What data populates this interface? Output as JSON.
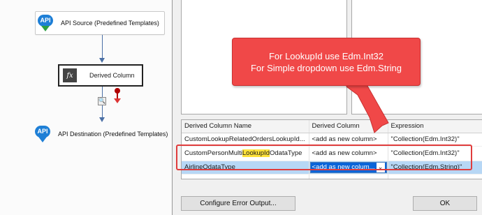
{
  "flow": {
    "source_label": "API Source (Predefined Templates)",
    "source_icon": "API",
    "derived_label": "Derived Column",
    "derived_icon": "fx",
    "destination_label": "API Destination (Predefined Templates)",
    "destination_icon": "API"
  },
  "callout": {
    "line1": "For LookupId use Edm.Int32",
    "line2": "For Simple dropdown use Edm.String",
    "color": "#f04848"
  },
  "grid": {
    "headers": [
      "Derived Column Name",
      "Derived Column",
      "Expression"
    ],
    "rows": [
      {
        "name": "CustomLookupRelatedOrdersLookupId...",
        "derived": "<add as new column>",
        "expression": "\"Collection(Edm.Int32)\""
      },
      {
        "name_pre": "CustomPersonMulti",
        "name_hl": "LookupId",
        "name_post": "OdataType",
        "derived": "<add as new column>",
        "expression": "\"Collection(Edm.Int32)\""
      },
      {
        "name": "AirlineOdataType",
        "derived": "<add as new colum...",
        "expression": "\"Collection(Edm.String)\""
      }
    ],
    "selected_row": 2
  },
  "buttons": {
    "configure_error": "Configure Error Output...",
    "ok": "OK"
  },
  "colors": {
    "selection": "#b7d7f5",
    "highlight": "#ffe23a",
    "annotation_red": "#e03c3c"
  }
}
